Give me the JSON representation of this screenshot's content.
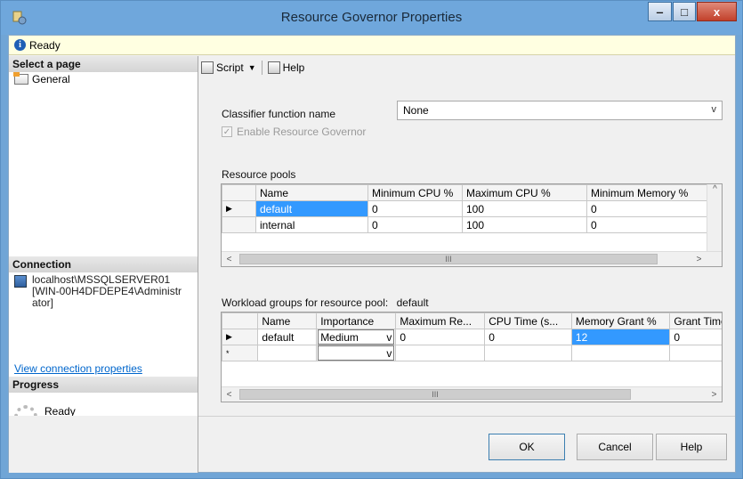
{
  "window": {
    "title": "Resource Governor Properties",
    "min": "‒",
    "max": "□",
    "close": "x"
  },
  "status": {
    "text": "Ready",
    "icon": "info-icon"
  },
  "sidebar": {
    "select_page_heading": "Select a page",
    "pages": [
      {
        "label": "General",
        "icon": "page-icon"
      }
    ],
    "connection_heading": "Connection",
    "connection_text": "localhost\\MSSQLSERVER01 [WIN-00H4DFDEPE4\\Administr ator]",
    "view_connection_link": "View connection properties",
    "progress_heading": "Progress",
    "progress_text": "Ready"
  },
  "toolbar": {
    "script_label": "Script",
    "help_label": "Help"
  },
  "form": {
    "classifier_label": "Classifier function name",
    "classifier_value": "None",
    "enable_label": "Enable Resource Governor",
    "enable_checked": true,
    "resource_pools_label": "Resource pools",
    "workload_label": "Workload groups for resource pool:",
    "workload_pool": "default"
  },
  "resource_pools": {
    "columns": [
      "Name",
      "Minimum CPU %",
      "Maximum CPU %",
      "Minimum Memory %"
    ],
    "rows": [
      {
        "marker": "▶",
        "cells": [
          "default",
          "0",
          "100",
          "0"
        ]
      },
      {
        "marker": "",
        "cells": [
          "internal",
          "0",
          "100",
          "0"
        ]
      }
    ]
  },
  "workload_groups": {
    "columns": [
      "Name",
      "Importance",
      "Maximum Re...",
      "CPU Time (s...",
      "Memory Grant %",
      "Grant Time-ou"
    ],
    "rows": [
      {
        "marker": "▶",
        "cells": [
          "default",
          "Medium",
          "0",
          "0",
          "12",
          "0"
        ]
      },
      {
        "marker": "*",
        "cells": [
          "",
          "",
          "",
          "",
          "",
          ""
        ]
      }
    ]
  },
  "buttons": {
    "ok": "OK",
    "cancel": "Cancel",
    "help": "Help"
  },
  "scroll": {
    "thumb_glyph": "III",
    "left": "<",
    "right": ">",
    "up": "^",
    "down": "v",
    "dropdown": "v"
  }
}
